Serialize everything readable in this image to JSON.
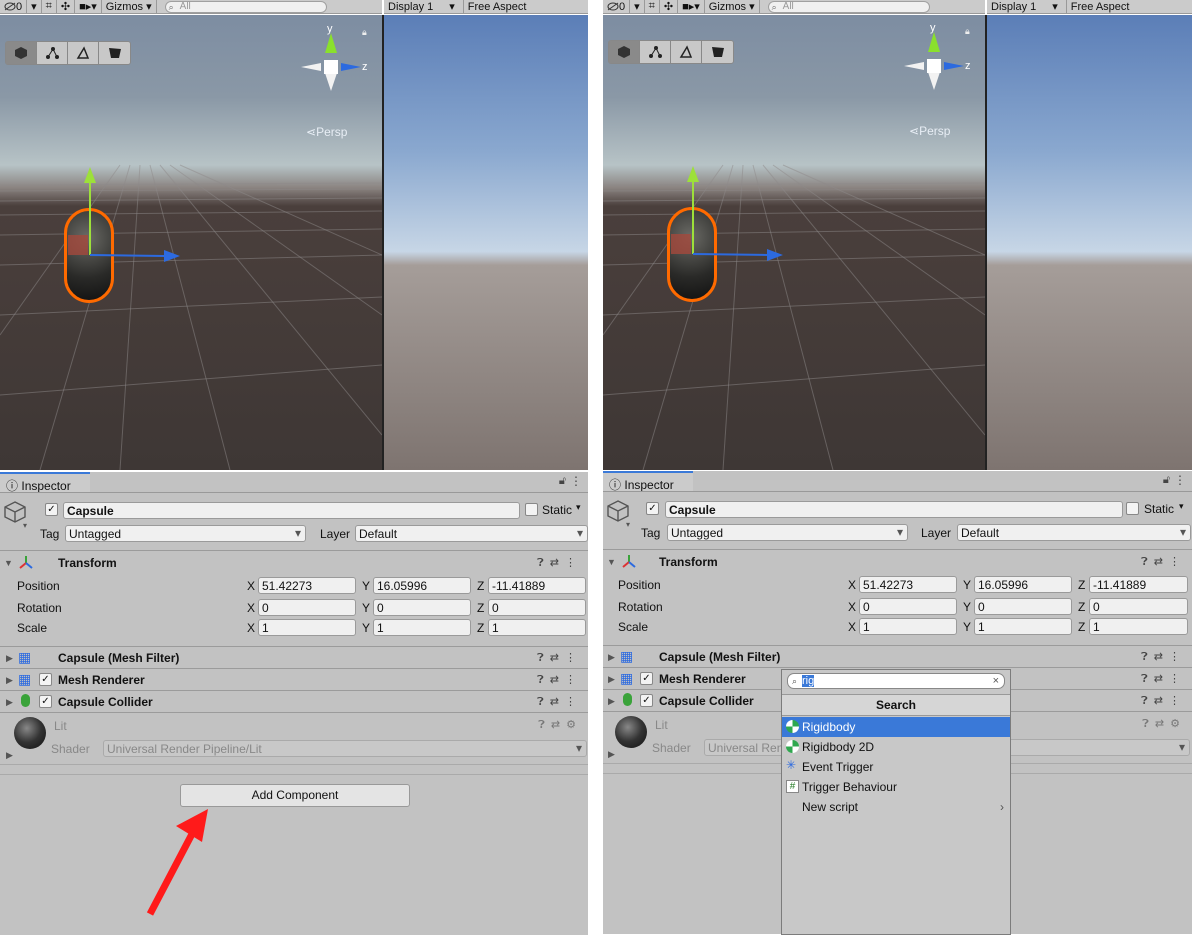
{
  "toolbar": {
    "hidden_count": "0",
    "gizmos": "Gizmos",
    "search_placeholder": "All"
  },
  "game": {
    "display": "Display 1",
    "aspect": "Free Aspect"
  },
  "scene": {
    "persp": "Persp",
    "axis_y": "y",
    "axis_z": "z"
  },
  "inspector": {
    "tab": "Inspector",
    "object_name": "Capsule",
    "static_label": "Static",
    "tag_label": "Tag",
    "tag_value": "Untagged",
    "layer_label": "Layer",
    "layer_value": "Default",
    "transform": {
      "title": "Transform",
      "rows": [
        {
          "label": "Position",
          "x": "51.42273",
          "y": "16.05996",
          "z": "-11.41889"
        },
        {
          "label": "Rotation",
          "x": "0",
          "y": "0",
          "z": "0"
        },
        {
          "label": "Scale",
          "x": "1",
          "y": "1",
          "z": "1"
        }
      ],
      "x": "X",
      "y": "Y",
      "z": "Z"
    },
    "components": [
      "Capsule (Mesh Filter)",
      "Mesh Renderer",
      "Capsule Collider"
    ],
    "material": {
      "name": "Lit",
      "shader_label": "Shader",
      "shader_value": "Universal Render Pipeline/Lit",
      "shader_truncated": "Universal Ren"
    },
    "add_component": "Add Component"
  },
  "popup": {
    "query": "rig",
    "header": "Search",
    "items": [
      "Rigidbody",
      "Rigidbody 2D",
      "Event Trigger",
      "Trigger Behaviour",
      "New script"
    ]
  },
  "colors": {
    "accent": "#3a79d8",
    "selection": "#ff6a00",
    "arrow": "#ff1a1a"
  }
}
